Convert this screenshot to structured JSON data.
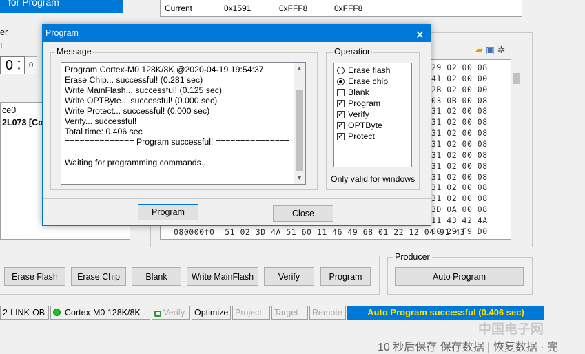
{
  "top_banner": {
    "label": "for Program",
    "arrow": "›"
  },
  "info_table": {
    "rows": [
      {
        "name": "Current",
        "c1": "0x1591",
        "c2": "0xFFF8",
        "c3": "0xFFF8"
      }
    ]
  },
  "left_panel": {
    "spin_value": "0",
    "spin_small": "0",
    "device_line1": "ce0",
    "device_line2": "2L073 [Co",
    "label_fragment": "er",
    "label_fragment2": "ı"
  },
  "hex_view": {
    "rows": [
      "29 02 00 08",
      "41 02 00 00",
      "2B 02 00 00",
      "03 0B 00 08",
      "31 02 00 08",
      "31 02 00 08",
      "31 02 00 08",
      "31 02 00 08",
      "31 02 00 08",
      "31 02 00 08",
      "31 02 00 08",
      "31 02 00 08",
      "31 02 00 08",
      "3D 0A 00 08",
      "11 43 42 4A",
      "00 29 F9 D0"
    ],
    "last_row": "080000f0  51 02 3D 4A 51 60 11 46 49 68 01 22 12 04 91 43",
    "icons": [
      "open-folder-icon",
      "save-icon",
      "settings-icon"
    ]
  },
  "action_buttons": [
    {
      "name": "erase-flash-button",
      "label": "Erase Flash"
    },
    {
      "name": "erase-chip-button",
      "label": "Erase Chip"
    },
    {
      "name": "blank-button",
      "label": "Blank"
    },
    {
      "name": "write-mainflash-button",
      "label": "Write MainFlash"
    },
    {
      "name": "verify-button",
      "label": "Verify"
    },
    {
      "name": "program-button",
      "label": "Program"
    }
  ],
  "producer": {
    "label": "Producer",
    "button": "Auto Program"
  },
  "status_bar": {
    "link": "2-LINK-OB",
    "device": "Cortex-M0 128K/8K",
    "verify": "Verify",
    "optimize": "Optimize",
    "project": "Project",
    "target": "Target",
    "remote": "Remote",
    "result": "Auto Program successful (0.406 sec)"
  },
  "bottom_text": "10 秒后保存 保存数据 | 恢复数据 · 完",
  "watermark": "中国电子网",
  "dialog": {
    "title": "Program",
    "message_label": "Message",
    "messages": [
      "Program Cortex-M0 128K/8K  @2020-04-19 19:54:37",
      "Erase Chip... successful! (0.281 sec)",
      "Write MainFlash... successful! (0.125 sec)",
      "Write OPTByte... successful! (0.000 sec)",
      "Write Protect... successful! (0.000 sec)",
      "Verify... successful!",
      "Total time: 0.406 sec",
      "============== Program successful! ===============",
      "",
      "Waiting for programming commands..."
    ],
    "operation_label": "Operation",
    "operations": [
      {
        "label": "Erase flash",
        "type": "radio",
        "checked": false
      },
      {
        "label": "Erase chip",
        "type": "radio",
        "checked": true
      },
      {
        "label": "Blank",
        "type": "check",
        "checked": false
      },
      {
        "label": "Program",
        "type": "check",
        "checked": true
      },
      {
        "label": "Verify",
        "type": "check",
        "checked": true
      },
      {
        "label": "OPTByte",
        "type": "check",
        "checked": true
      },
      {
        "label": "Protect",
        "type": "check",
        "checked": true
      }
    ],
    "only_valid": "Only valid for windows",
    "program_button": "Program",
    "close_button": "Close"
  }
}
